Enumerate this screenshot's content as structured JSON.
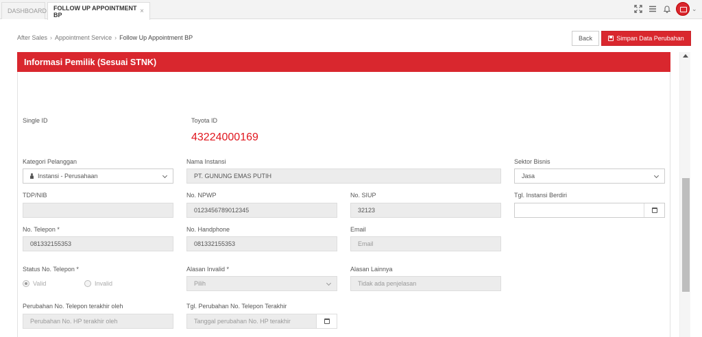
{
  "tabs": [
    {
      "label": "DASHBOARD"
    },
    {
      "label": "FOLLOW UP APPOINTMENT BP",
      "close": "×"
    }
  ],
  "breadcrumb": {
    "items": [
      "After Sales",
      "Appointment Service",
      "Follow Up Appointment BP"
    ],
    "separator": "›"
  },
  "actions": {
    "back_label": "Back",
    "save_label": "Simpan Data Perubahan"
  },
  "panel": {
    "title": "Informasi Pemilik (Sesuai STNK)"
  },
  "form": {
    "single_id": {
      "label": "Single ID"
    },
    "toyota_id": {
      "label": "Toyota ID",
      "value": "43224000169"
    },
    "kategori_pelanggan": {
      "label": "Kategori Pelanggan",
      "value": "Instansi - Perusahaan"
    },
    "nama_instansi": {
      "label": "Nama Instansi",
      "value": "PT. GUNUNG EMAS PUTIH"
    },
    "sektor_bisnis": {
      "label": "Sektor Bisnis",
      "value": "Jasa"
    },
    "tdp_nib": {
      "label": "TDP/NIB",
      "value": ""
    },
    "no_npwp": {
      "label": "No. NPWP",
      "value": "0123456789012345"
    },
    "no_siup": {
      "label": "No. SIUP",
      "value": "32123"
    },
    "tgl_instansi_berdiri": {
      "label": "Tgl. Instansi Berdiri",
      "value": ""
    },
    "no_telepon": {
      "label": "No. Telepon *",
      "value": "081332155353"
    },
    "no_handphone": {
      "label": "No. Handphone",
      "value": "081332155353"
    },
    "email": {
      "label": "Email",
      "placeholder": "Email"
    },
    "status_no_telepon": {
      "label": "Status No. Telepon *",
      "options": [
        "Valid",
        "Invalid"
      ],
      "selected": "Valid"
    },
    "alasan_invalid": {
      "label": "Alasan Invalid *",
      "placeholder": "Pilih"
    },
    "alasan_lainnya": {
      "label": "Alasan Lainnya",
      "placeholder": "Tidak ada penjelasan"
    },
    "perubahan_oleh": {
      "label": "Perubahan No. Telepon terakhir oleh",
      "placeholder": "Perubahan No. HP terakhir oleh"
    },
    "tgl_perubahan": {
      "label": "Tgl. Perubahan No. Telepon Terakhir",
      "placeholder": "Tanggal perubahan No. HP terakhir"
    }
  },
  "colors": {
    "accent": "#d9272e",
    "toyota_id_text": "#e0161e"
  },
  "icons": [
    "expand-icon",
    "menu-icon",
    "bell-icon",
    "user-avatar-icon",
    "calendar-icon",
    "save-icon",
    "person-icon"
  ]
}
